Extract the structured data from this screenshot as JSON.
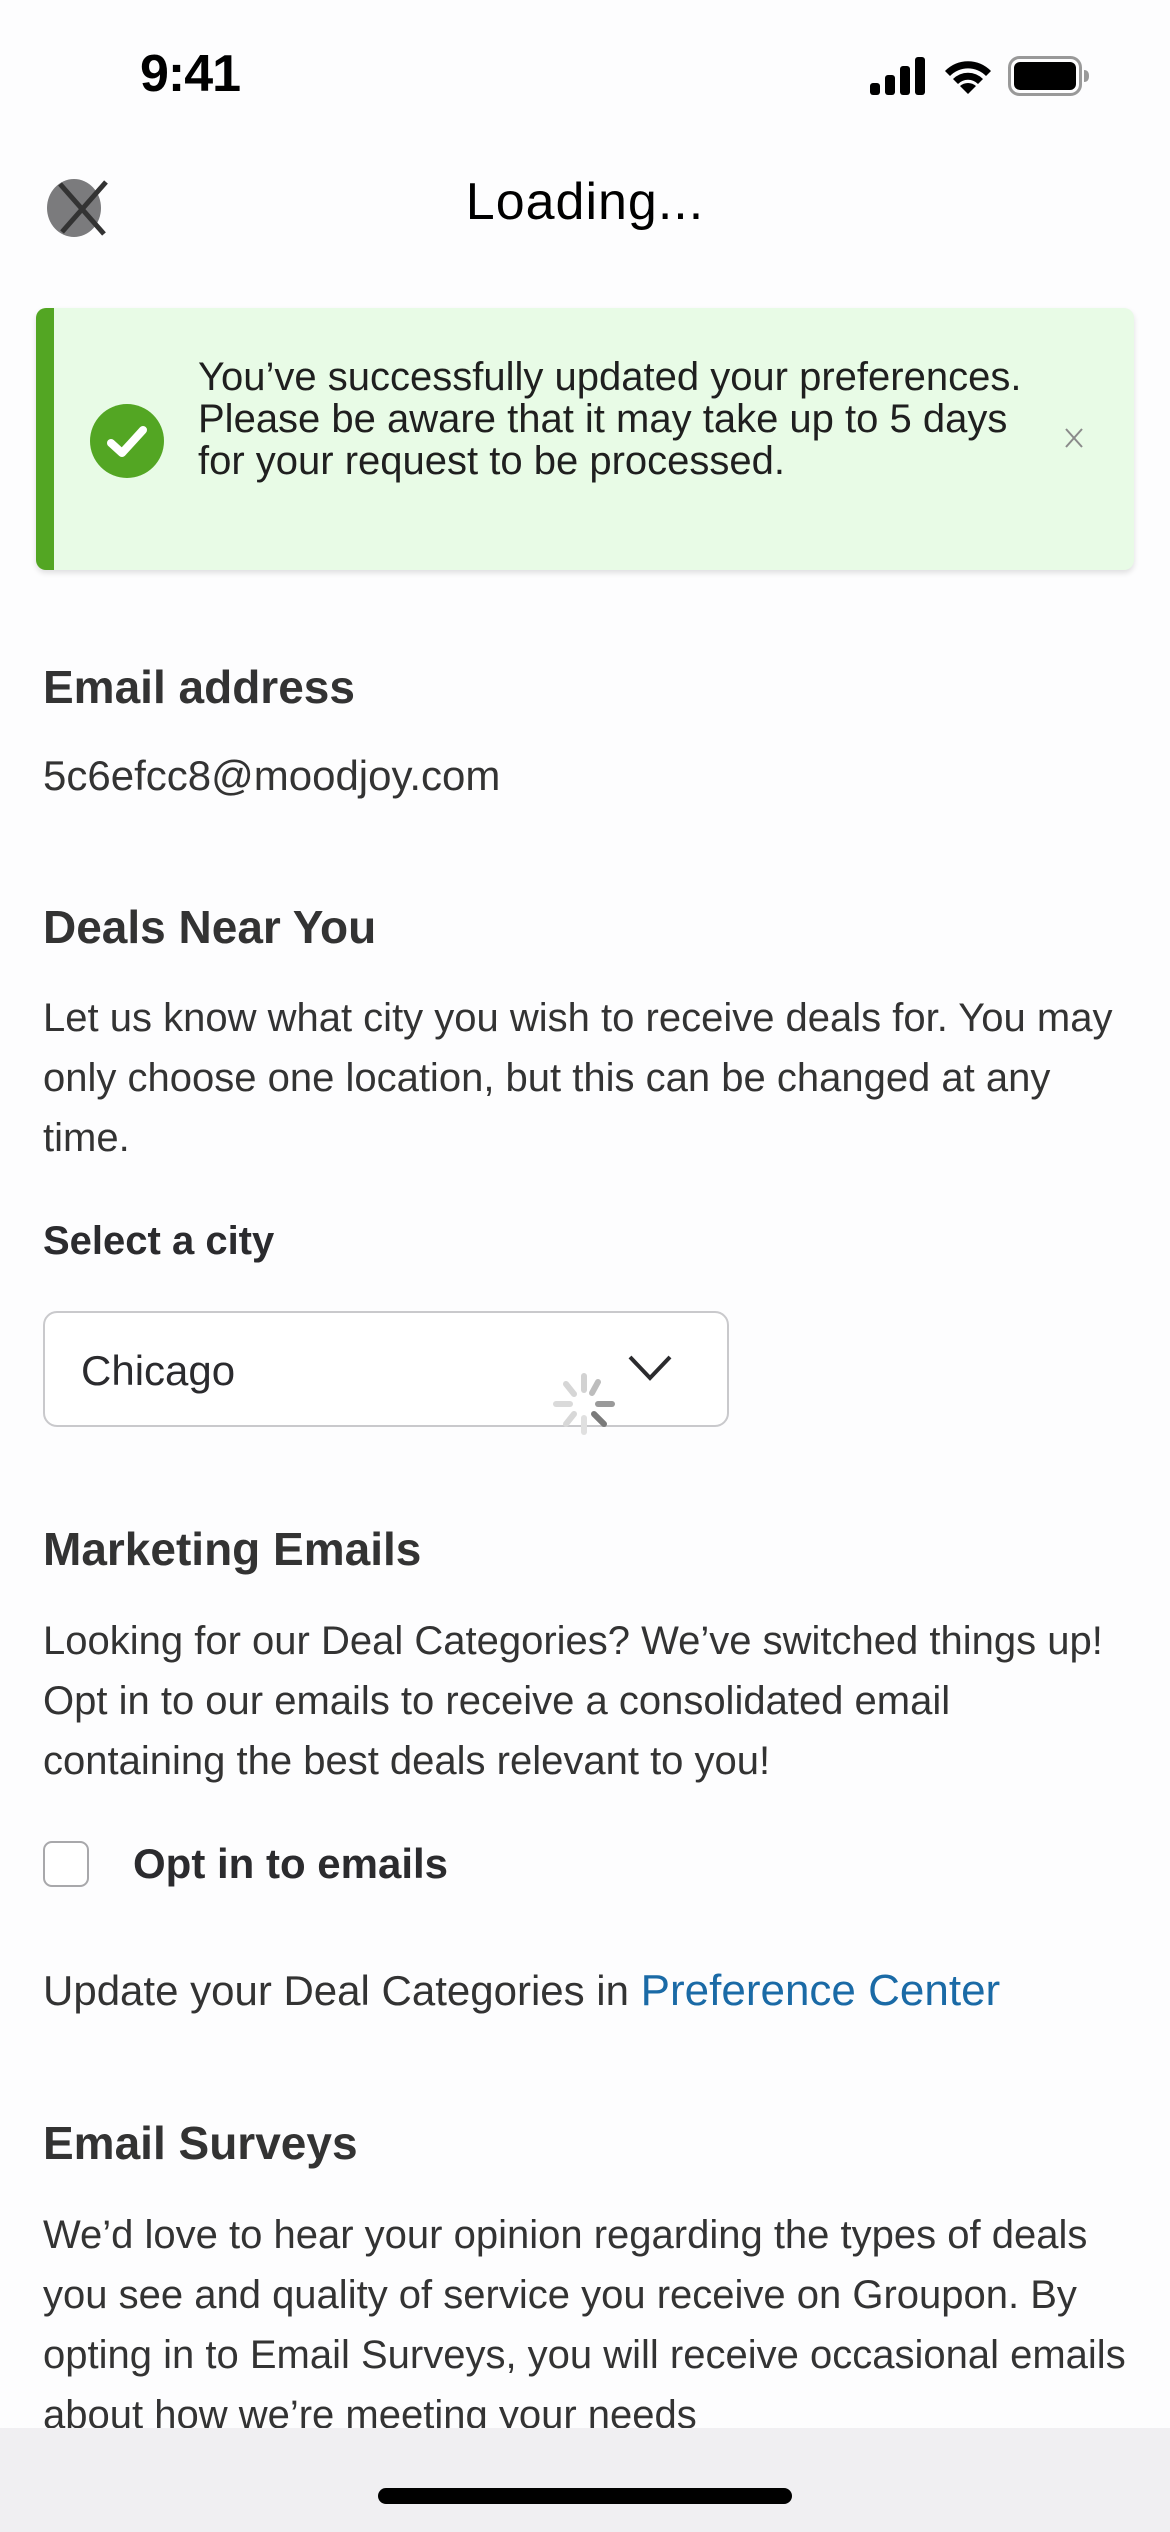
{
  "status_bar": {
    "time": "9:41",
    "icons": [
      "cellular-signal-icon",
      "wifi-icon",
      "battery-icon"
    ]
  },
  "nav": {
    "title": "Loading...",
    "close_icon": "close-icon"
  },
  "banner": {
    "icon": "check-circle-icon",
    "message": "You’ve successfully updated your preferences. Please be aware that it may take up to 5 days for your request to be processed.",
    "close_icon": "close-icon",
    "colors": {
      "accent": "#53a623",
      "background": "#e8fbe6"
    }
  },
  "email_section": {
    "heading": "Email address",
    "value": "5c6efcc8@moodjoy.com"
  },
  "deals_section": {
    "heading": "Deals Near You",
    "description": "Let us know what city you wish to receive deals for. You may only choose one location, but this can be changed at any time.",
    "select_label": "Select a city",
    "selected_city": "Chicago"
  },
  "marketing_section": {
    "heading": "Marketing Emails",
    "description": "Looking for our Deal Categories? We’ve switched things up! Opt in to our emails to receive a consolidated email containing the best deals relevant to you!",
    "checkbox_label": "Opt in to emails",
    "checkbox_checked": false,
    "update_prefix": "Update your Deal Categories in ",
    "link_label": "Preference Center",
    "link_color": "#1a6aa6"
  },
  "surveys_section": {
    "heading": "Email Surveys",
    "description": "We’d love to hear your opinion regarding the types of deals you see and quality of service you receive on Groupon. By opting in to Email Surveys, you will receive occasional emails about how we’re meeting your needs"
  }
}
